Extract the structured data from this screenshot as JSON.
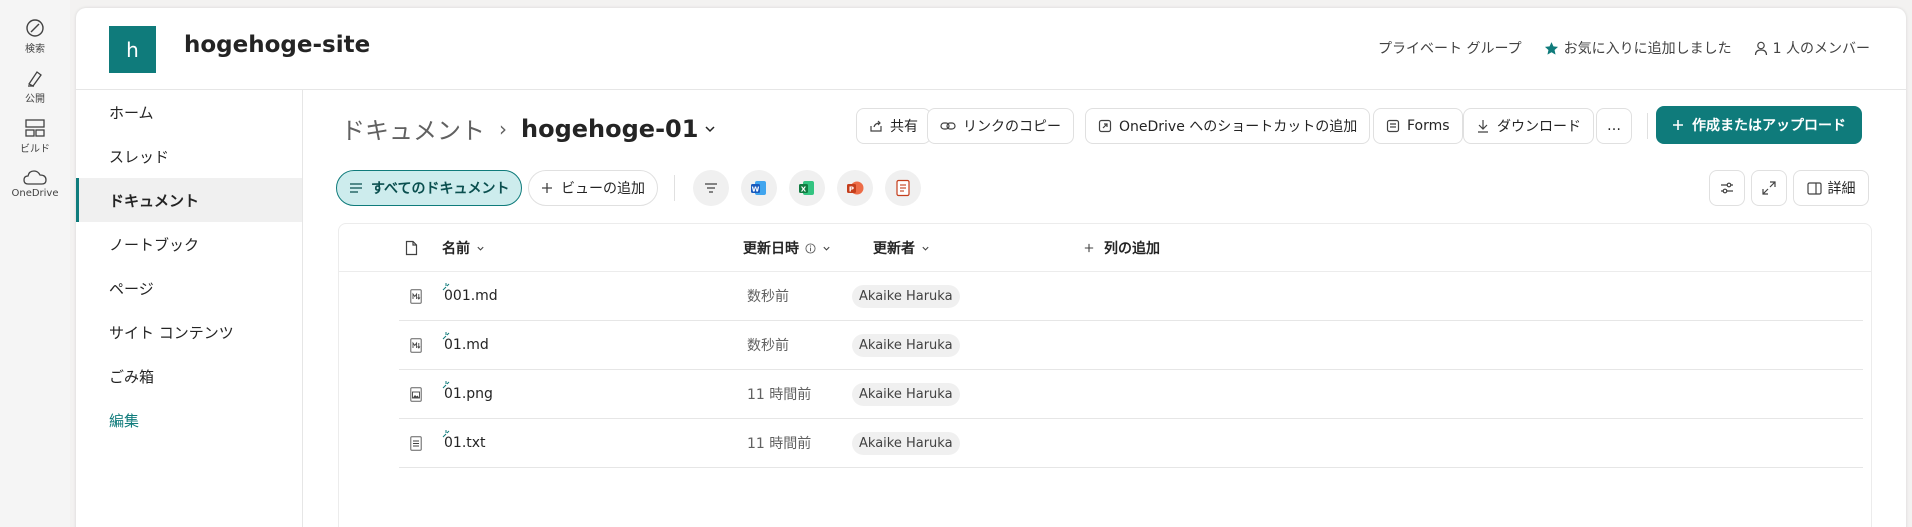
{
  "rail": {
    "items": [
      {
        "label": "検索",
        "icon": "search-icon"
      },
      {
        "label": "公開",
        "icon": "publish-icon"
      },
      {
        "label": "ビルド",
        "icon": "build-icon"
      },
      {
        "label": "OneDrive",
        "icon": "onedrive-icon"
      }
    ]
  },
  "site": {
    "logo_letter": "h",
    "title": "hogehoge-site",
    "privacy": "プライベート グループ",
    "favorite": "お気に入りに追加しました",
    "members": "1 人のメンバー"
  },
  "nav": {
    "items": [
      "ホーム",
      "スレッド",
      "ドキュメント",
      "ノートブック",
      "ページ",
      "サイト コンテンツ",
      "ごみ箱"
    ],
    "edit": "編集",
    "active": "ドキュメント"
  },
  "breadcrumb": {
    "root": "ドキュメント",
    "separator": "›",
    "current": "hogehoge-01"
  },
  "commands": {
    "share": "共有",
    "copy_link": "リンクのコピー",
    "onedrive_shortcut": "OneDrive へのショートカットの追加",
    "forms": "Forms",
    "download": "ダウンロード",
    "more": "…",
    "create_upload": "作成またはアップロード"
  },
  "viewbar": {
    "all_docs": "すべてのドキュメント",
    "add_view": "ビューの追加",
    "details": "詳細"
  },
  "table": {
    "headers": {
      "name": "名前",
      "modified": "更新日時",
      "modified_by": "更新者",
      "add_column": "列の追加"
    },
    "rows": [
      {
        "name": "001.md",
        "modified": "数秒前",
        "modified_by": "Akaike Haruka",
        "type": "md"
      },
      {
        "name": "01.md",
        "modified": "数秒前",
        "modified_by": "Akaike Haruka",
        "type": "md"
      },
      {
        "name": "01.png",
        "modified": "11 時間前",
        "modified_by": "Akaike Haruka",
        "type": "png"
      },
      {
        "name": "01.txt",
        "modified": "11 時間前",
        "modified_by": "Akaike Haruka",
        "type": "txt"
      }
    ]
  },
  "colors": {
    "accent": "#0f7b7b",
    "word": "#185abd",
    "excel": "#107c41",
    "powerpoint": "#c43e1c"
  }
}
